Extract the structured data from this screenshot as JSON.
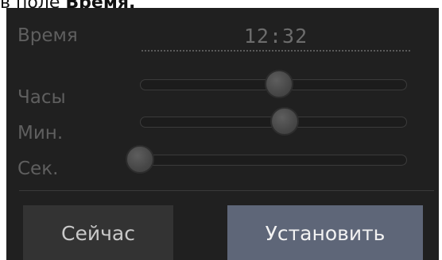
{
  "caption": {
    "prefix": "в поле ",
    "bold": "Время."
  },
  "time_field": {
    "label": "Время",
    "value": "12:32"
  },
  "sliders": {
    "hours": {
      "label": "Часы",
      "value": 12,
      "min": 0,
      "max": 23
    },
    "minutes": {
      "label": "Мин.",
      "value": 32,
      "min": 0,
      "max": 59
    },
    "seconds": {
      "label": "Сек.",
      "value": 0,
      "min": 0,
      "max": 59
    }
  },
  "buttons": {
    "now_label": "Сейчас",
    "set_label": "Установить"
  },
  "colors": {
    "panel_bg": "#202020",
    "button_bg": "#333333",
    "primary_button_bg": "#5e6678",
    "label_text": "#5f5f5f"
  }
}
